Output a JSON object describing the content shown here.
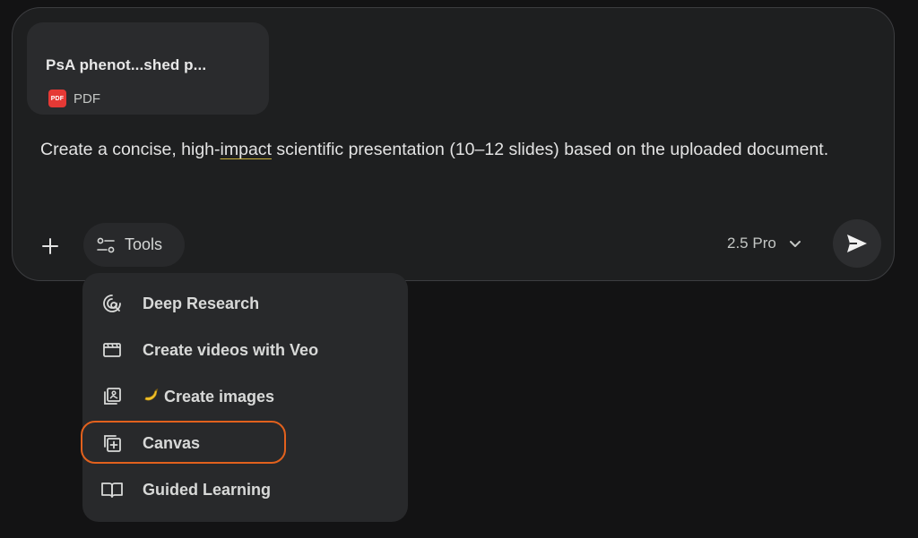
{
  "attachment": {
    "name": "PsA phenot...shed p...",
    "type_icon": "pdf-icon",
    "type_icon_text": "PDF",
    "type_label": "PDF"
  },
  "prompt": {
    "before": "Create a concise, high-",
    "flagged": "impact",
    "after": " scientific presentation (10–12 slides) based on the uploaded document."
  },
  "toolbar": {
    "add_icon": "plus-icon",
    "tools_icon": "tools-sliders-icon",
    "tools_label": "Tools",
    "model_label": "2.5 Pro",
    "model_icon": "chevron-down-icon",
    "send_icon": "send-icon"
  },
  "tools_menu": {
    "items": [
      {
        "label": "Deep Research",
        "icon": "deep-research-icon"
      },
      {
        "label": "Create videos with Veo",
        "icon": "video-clapper-icon"
      },
      {
        "label": "Create images",
        "icon": "image-gallery-icon",
        "emoji_icon": "banana-icon"
      },
      {
        "label": "Canvas",
        "icon": "canvas-icon",
        "highlighted": true
      },
      {
        "label": "Guided Learning",
        "icon": "book-icon"
      }
    ]
  },
  "colors": {
    "background": "#131314",
    "surface": "#1e1f20",
    "menu": "#28292b",
    "highlight": "#e2611d",
    "pdf": "#e53935"
  }
}
